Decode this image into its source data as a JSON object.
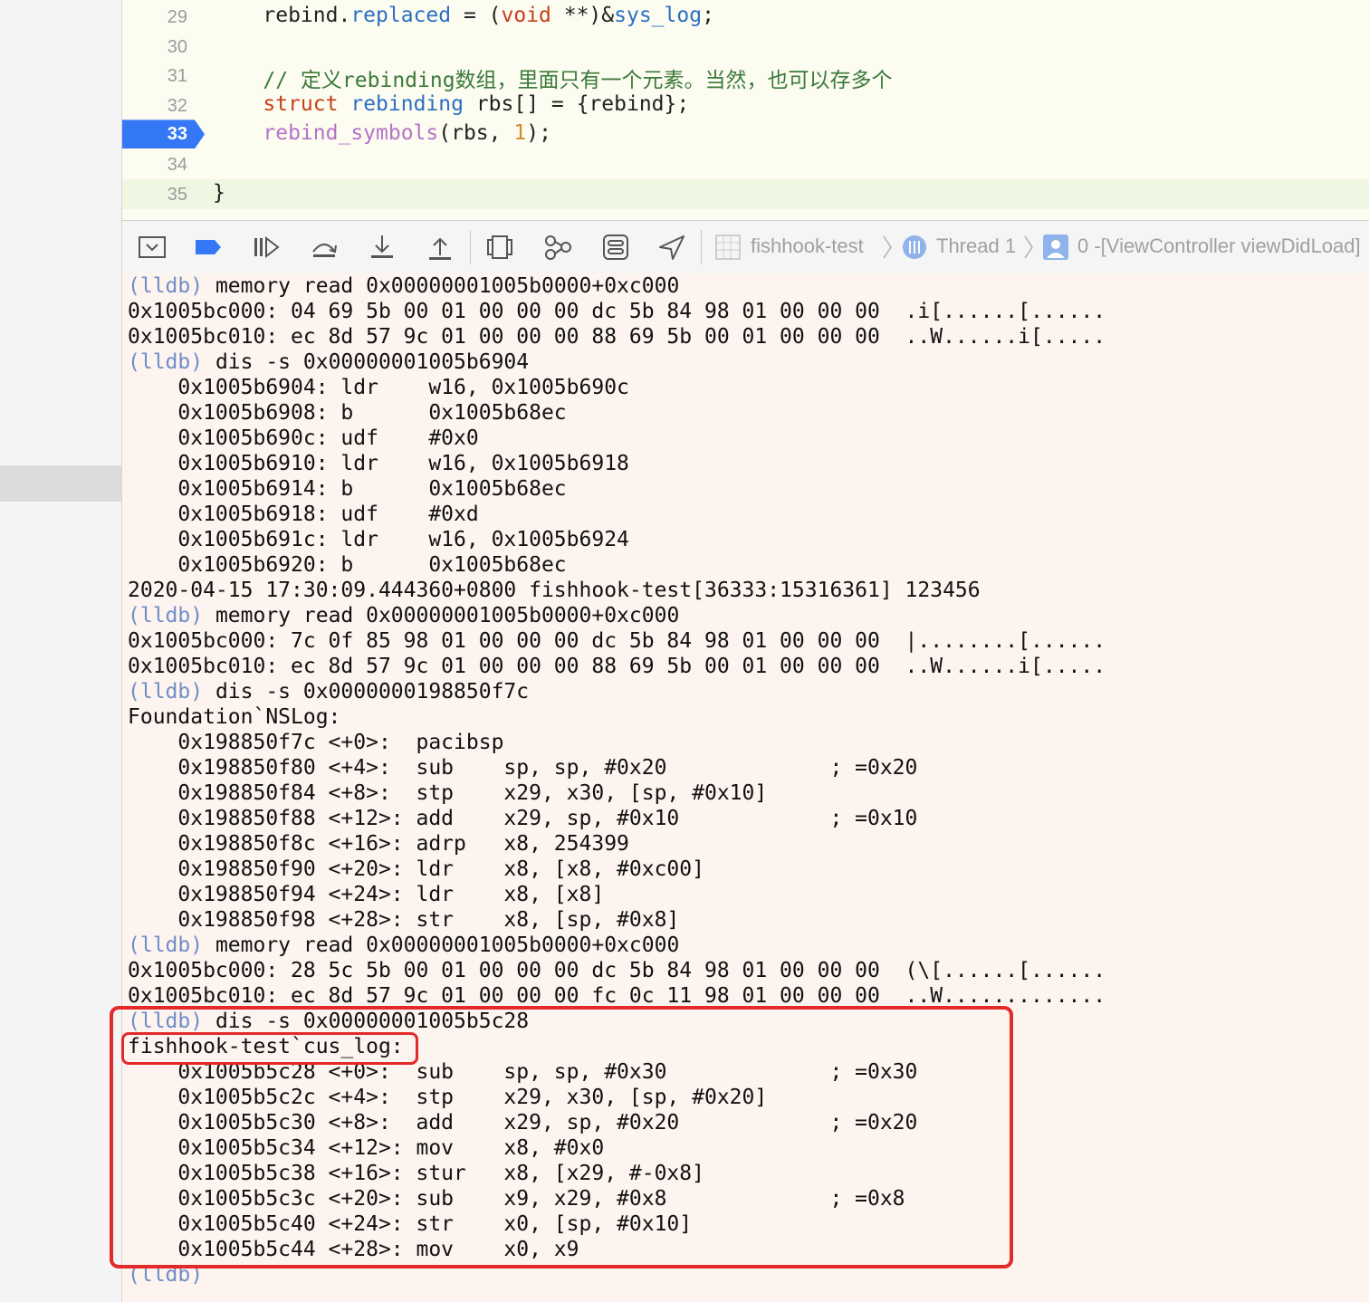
{
  "editor": {
    "lines": [
      {
        "num": "29",
        "parts": [
          {
            "t": "    rebind.",
            "c": ""
          },
          {
            "t": "replaced",
            "c": "ty"
          },
          {
            "t": " = (",
            "c": ""
          },
          {
            "t": "void",
            "c": "kw"
          },
          {
            "t": " **)&",
            "c": ""
          },
          {
            "t": "sys_log",
            "c": "ty"
          },
          {
            "t": ";",
            "c": ""
          }
        ]
      },
      {
        "num": "30",
        "parts": []
      },
      {
        "num": "31",
        "parts": [
          {
            "t": "    // 定义rebinding数组，里面只有一个元素。当然，也可以存多个",
            "c": "cm"
          }
        ]
      },
      {
        "num": "32",
        "parts": [
          {
            "t": "    ",
            "c": ""
          },
          {
            "t": "struct",
            "c": "kw"
          },
          {
            "t": " ",
            "c": ""
          },
          {
            "t": "rebinding",
            "c": "ty"
          },
          {
            "t": " rbs[] = {rebind};",
            "c": ""
          }
        ]
      },
      {
        "num": "33",
        "parts": [
          {
            "t": "    ",
            "c": ""
          },
          {
            "t": "rebind_symbols",
            "c": "fn"
          },
          {
            "t": "(rbs, ",
            "c": ""
          },
          {
            "t": "1",
            "c": "nm"
          },
          {
            "t": ");",
            "c": ""
          }
        ]
      },
      {
        "num": "34",
        "parts": []
      },
      {
        "num": "35",
        "parts": [
          {
            "t": "}",
            "c": ""
          }
        ]
      }
    ],
    "current_line": "33",
    "highlight_line": "35"
  },
  "toolbar": {
    "breadcrumb": {
      "target": "fishhook-test",
      "thread": "Thread 1",
      "frame": "0 -[ViewController viewDidLoad]"
    }
  },
  "console": {
    "lines": [
      {
        "p": "(lldb)",
        "t": " memory read 0x00000001005b0000+0xc000"
      },
      {
        "p": "",
        "t": "0x1005bc000: 04 69 5b 00 01 00 00 00 dc 5b 84 98 01 00 00 00  .i[......[......"
      },
      {
        "p": "",
        "t": "0x1005bc010: ec 8d 57 9c 01 00 00 00 88 69 5b 00 01 00 00 00  ..W......i[....."
      },
      {
        "p": "(lldb)",
        "t": " dis -s 0x00000001005b6904"
      },
      {
        "p": "",
        "t": "    0x1005b6904: ldr    w16, 0x1005b690c"
      },
      {
        "p": "",
        "t": "    0x1005b6908: b      0x1005b68ec"
      },
      {
        "p": "",
        "t": "    0x1005b690c: udf    #0x0"
      },
      {
        "p": "",
        "t": "    0x1005b6910: ldr    w16, 0x1005b6918"
      },
      {
        "p": "",
        "t": "    0x1005b6914: b      0x1005b68ec"
      },
      {
        "p": "",
        "t": "    0x1005b6918: udf    #0xd"
      },
      {
        "p": "",
        "t": "    0x1005b691c: ldr    w16, 0x1005b6924"
      },
      {
        "p": "",
        "t": "    0x1005b6920: b      0x1005b68ec"
      },
      {
        "p": "",
        "t": "2020-04-15 17:30:09.444360+0800 fishhook-test[36333:15316361] 123456"
      },
      {
        "p": "(lldb)",
        "t": " memory read 0x00000001005b0000+0xc000"
      },
      {
        "p": "",
        "t": "0x1005bc000: 7c 0f 85 98 01 00 00 00 dc 5b 84 98 01 00 00 00  |........[......"
      },
      {
        "p": "",
        "t": "0x1005bc010: ec 8d 57 9c 01 00 00 00 88 69 5b 00 01 00 00 00  ..W......i[....."
      },
      {
        "p": "(lldb)",
        "t": " dis -s 0x0000000198850f7c"
      },
      {
        "p": "",
        "t": "Foundation`NSLog:"
      },
      {
        "p": "",
        "t": "    0x198850f7c <+0>:  pacibsp"
      },
      {
        "p": "",
        "t": "    0x198850f80 <+4>:  sub    sp, sp, #0x20             ; =0x20"
      },
      {
        "p": "",
        "t": "    0x198850f84 <+8>:  stp    x29, x30, [sp, #0x10]"
      },
      {
        "p": "",
        "t": "    0x198850f88 <+12>: add    x29, sp, #0x10            ; =0x10"
      },
      {
        "p": "",
        "t": "    0x198850f8c <+16>: adrp   x8, 254399"
      },
      {
        "p": "",
        "t": "    0x198850f90 <+20>: ldr    x8, [x8, #0xc00]"
      },
      {
        "p": "",
        "t": "    0x198850f94 <+24>: ldr    x8, [x8]"
      },
      {
        "p": "",
        "t": "    0x198850f98 <+28>: str    x8, [sp, #0x8]"
      },
      {
        "p": "(lldb)",
        "t": " memory read 0x00000001005b0000+0xc000"
      },
      {
        "p": "",
        "t": "0x1005bc000: 28 5c 5b 00 01 00 00 00 dc 5b 84 98 01 00 00 00  (\\[......[......"
      },
      {
        "p": "",
        "t": "0x1005bc010: ec 8d 57 9c 01 00 00 00 fc 0c 11 98 01 00 00 00  ..W............."
      },
      {
        "p": "(lldb)",
        "t": " dis -s 0x00000001005b5c28"
      },
      {
        "p": "",
        "t": "fishhook-test`cus_log:"
      },
      {
        "p": "",
        "t": "    0x1005b5c28 <+0>:  sub    sp, sp, #0x30             ; =0x30"
      },
      {
        "p": "",
        "t": "    0x1005b5c2c <+4>:  stp    x29, x30, [sp, #0x20]"
      },
      {
        "p": "",
        "t": "    0x1005b5c30 <+8>:  add    x29, sp, #0x20            ; =0x20"
      },
      {
        "p": "",
        "t": "    0x1005b5c34 <+12>: mov    x8, #0x0"
      },
      {
        "p": "",
        "t": "    0x1005b5c38 <+16>: stur   x8, [x29, #-0x8]"
      },
      {
        "p": "",
        "t": "    0x1005b5c3c <+20>: sub    x9, x29, #0x8             ; =0x8"
      },
      {
        "p": "",
        "t": "    0x1005b5c40 <+24>: str    x0, [sp, #0x10]"
      },
      {
        "p": "",
        "t": "    0x1005b5c44 <+28>: mov    x0, x9"
      },
      {
        "p": "(lldb)",
        "t": ""
      }
    ]
  }
}
